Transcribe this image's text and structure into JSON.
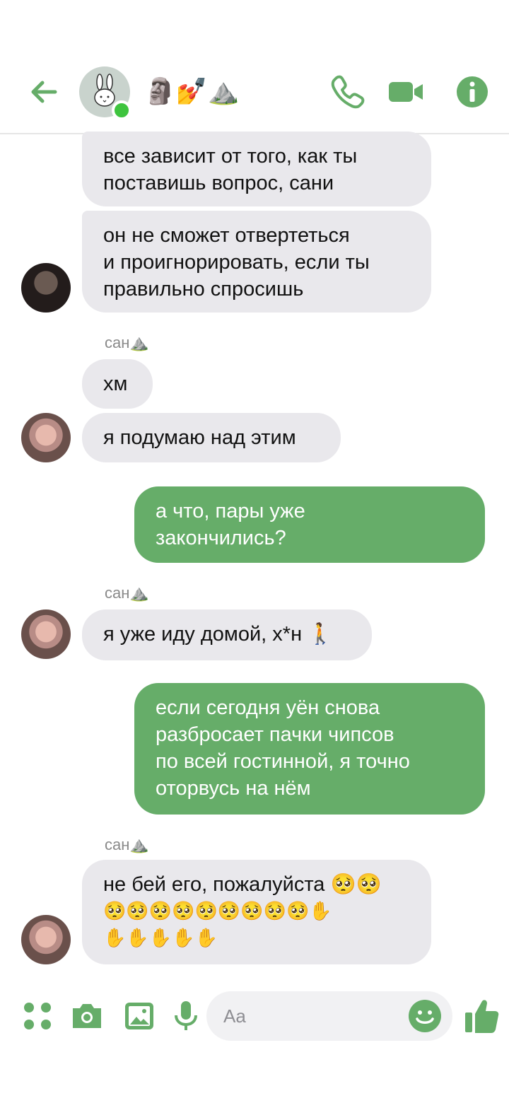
{
  "header": {
    "title": "🗿💅⛰️",
    "back_icon": "arrow-left-icon",
    "call_icon": "phone-icon",
    "video_icon": "video-camera-icon",
    "info_icon": "info-icon",
    "accent": "#66ad69"
  },
  "messages": [
    {
      "side": "in",
      "text_lines": [
        "все зависит от того, как ты",
        "поставишь вопрос, сани"
      ]
    },
    {
      "side": "in",
      "text_lines": [
        "он не сможет отвертеться",
        "и проигнорировать, если ты",
        "правильно спросишь"
      ]
    },
    {
      "sender": "сан⛰️"
    },
    {
      "side": "in",
      "text_lines": [
        "хм"
      ]
    },
    {
      "side": "in",
      "text_lines": [
        "я подумаю над этим"
      ]
    },
    {
      "side": "out",
      "text_lines": [
        "а что, пары уже",
        "закончились?"
      ]
    },
    {
      "sender": "сан⛰️"
    },
    {
      "side": "in",
      "text_lines": [
        "я уже иду домой, х*н 🚶"
      ]
    },
    {
      "side": "out",
      "text_lines": [
        "если сегодня уён снова",
        "разбросает пачки чипсов",
        "по всей гостинной, я точно",
        "оторвусь на нём"
      ]
    },
    {
      "sender": "сан⛰️"
    },
    {
      "side": "in",
      "text_lines": [
        "не бей его, пожалуйста 🥺🥺",
        "🥺🥺🥺🥺🥺🥺🥺🥺🥺✋",
        "✋✋✋✋✋"
      ]
    }
  ],
  "composer": {
    "placeholder": "Aa",
    "icons": [
      "apps-icon",
      "camera-icon",
      "image-icon",
      "microphone-icon",
      "smiley-icon",
      "thumbs-up-icon"
    ]
  }
}
